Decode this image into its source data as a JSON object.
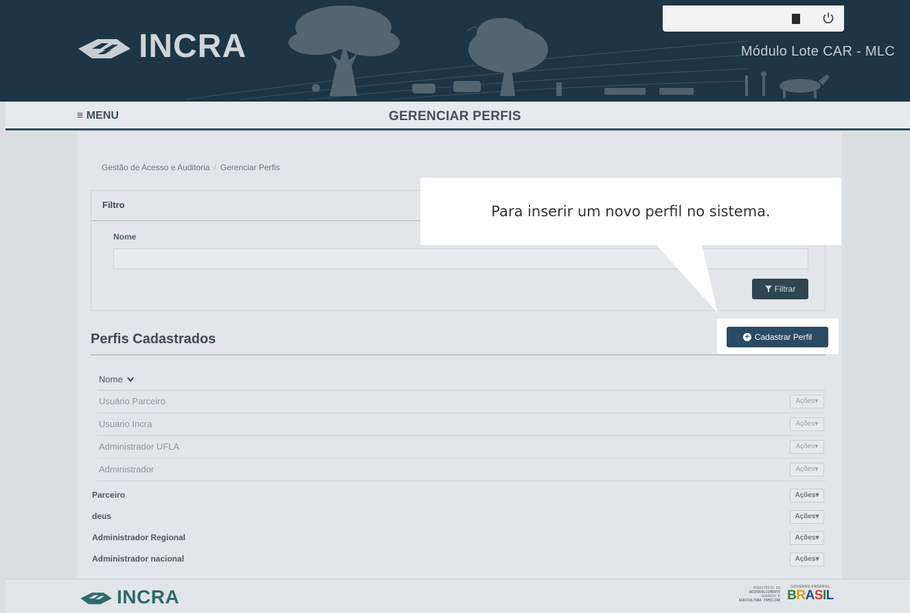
{
  "header": {
    "logo_text": "INCRA",
    "module_title": "Módulo Lote CAR - MLC",
    "book_icon": "book-icon",
    "power_icon": "power-icon"
  },
  "nav": {
    "menu_label": "≡ MENU",
    "page_title": "GERENCIAR PERFIS"
  },
  "breadcrumb": {
    "items": [
      "Gestão de Acesso e Auditoria",
      "Gerenciar Perfis"
    ],
    "separator": "/"
  },
  "filter": {
    "title": "Filtro",
    "name_label": "Nome",
    "name_value": "",
    "button_label": "Filtrar"
  },
  "profiles": {
    "section_title": "Perfis Cadastrados",
    "add_button_label": "Cadastrar Perfil",
    "column_header": "Nome",
    "sort_icon": "chevron-down-icon",
    "actions_label": "Ações",
    "rows": [
      {
        "name": "Usuário Parceiro"
      },
      {
        "name": "Usuario Incra"
      },
      {
        "name": "Administrador UFLA"
      },
      {
        "name": "Administrador"
      },
      {
        "name": "Parceiro"
      },
      {
        "name": "deus"
      },
      {
        "name": "Administrador Regional"
      },
      {
        "name": "Administrador nacional"
      }
    ]
  },
  "callout": {
    "text": "Para inserir um novo perfil no sistema."
  },
  "footer": {
    "logo_text": "INCRA",
    "mda_lines": [
      "MINISTÉRIO DO",
      "DESENVOLVIMENTO",
      "AGRÁRIO E",
      "AGRICULTURA FAMILIAR"
    ],
    "gov_label": "GOVERNO FEDERAL",
    "brasil_word": "BRASIL"
  },
  "colors": {
    "header_bg": "#1d3545",
    "primary_button": "#2b4a63",
    "nav_border": "#2e4b60"
  }
}
